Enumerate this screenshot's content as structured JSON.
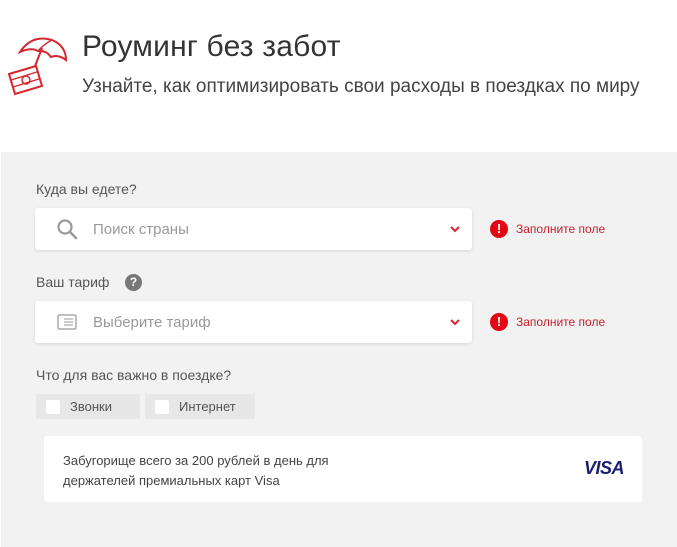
{
  "header": {
    "title": "Роуминг без забот",
    "subtitle": "Узнайте, как оптимизировать свои расходы в поездках по миру",
    "logo_icon": "umbrella-money-icon",
    "brand_color": "#e30613"
  },
  "form": {
    "destination": {
      "label": "Куда вы едете?",
      "placeholder": "Поиск страны",
      "icon": "search-icon",
      "error": "Заполните поле"
    },
    "tariff": {
      "label": "Ваш тариф",
      "help": "?",
      "placeholder": "Выберите тариф",
      "icon": "sim-card-icon",
      "error": "Заполните поле"
    },
    "importance": {
      "label": "Что для вас важно в поездке?",
      "options": [
        {
          "label": "Звонки",
          "checked": false
        },
        {
          "label": "Интернет",
          "checked": false
        }
      ]
    }
  },
  "promo": {
    "text": "Забугорище всего за 200 рублей в день для держателей премиальных карт Visa",
    "brand": "VISA"
  },
  "colors": {
    "panel_bg": "#f2f2f2",
    "error": "#c8202a",
    "error_icon": "#e30613",
    "visa": "#1a1f71"
  }
}
